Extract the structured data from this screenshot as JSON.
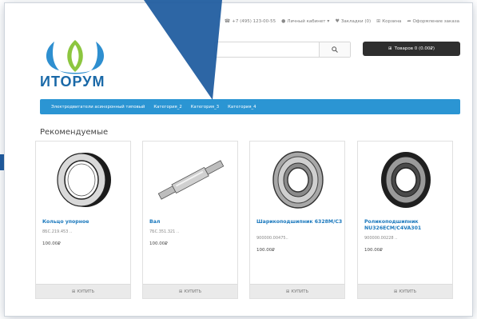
{
  "topbar": {
    "phone": "+7 (495) 123-00-55",
    "account": "Личный кабинет",
    "wishlist": "Закладки (0)",
    "cart": "Корзина",
    "checkout": "Оформление заказа"
  },
  "brand": {
    "name": "ИТОРУМ"
  },
  "search": {
    "placeholder": ""
  },
  "cart_button": {
    "label": "Товаров 0 (0.00₽)"
  },
  "nav": [
    {
      "label": "Электродвигатели асинхронный типовый"
    },
    {
      "label": "Категория_2"
    },
    {
      "label": "Категория_3"
    },
    {
      "label": "Категория_4"
    }
  ],
  "section": {
    "title": "Рекомендуемые"
  },
  "products": [
    {
      "name": "Кольцо упорное",
      "sku": "8БС.219.453 ..",
      "price": "100.00₽",
      "buy": "КУПИТЬ",
      "image": "thrust-ring-image"
    },
    {
      "name": "Вал",
      "sku": "7БС.351.321 ..",
      "price": "100.00₽",
      "buy": "КУПИТЬ",
      "image": "shaft-image"
    },
    {
      "name": "Шарикоподшипник 6328М/С3",
      "sku": "900000.00475..",
      "price": "100.00₽",
      "buy": "КУПИТЬ",
      "image": "ball-bearing-image"
    },
    {
      "name": "Роликоподшипник NU326ECM/C4VA301",
      "sku": "900000.00228 ..",
      "price": "100.00₽",
      "buy": "КУПИТЬ",
      "image": "roller-bearing-image"
    }
  ],
  "colors": {
    "accent": "#2b95d3",
    "link": "#1a78bd",
    "cart_button": "#2e2e2e",
    "overlay_arrow": "#1d5a9e"
  }
}
